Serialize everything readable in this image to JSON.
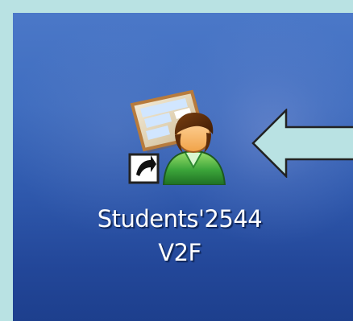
{
  "desktop": {
    "shortcut": {
      "label_line_1": "Students'2544",
      "label_line_2": "V2F",
      "icon": "student-profile-icon",
      "overlay_icon": "shortcut-arrow-icon"
    },
    "pointer": {
      "icon": "left-arrow-icon",
      "fill": "#b9e2e3",
      "outline": "#222222"
    }
  }
}
